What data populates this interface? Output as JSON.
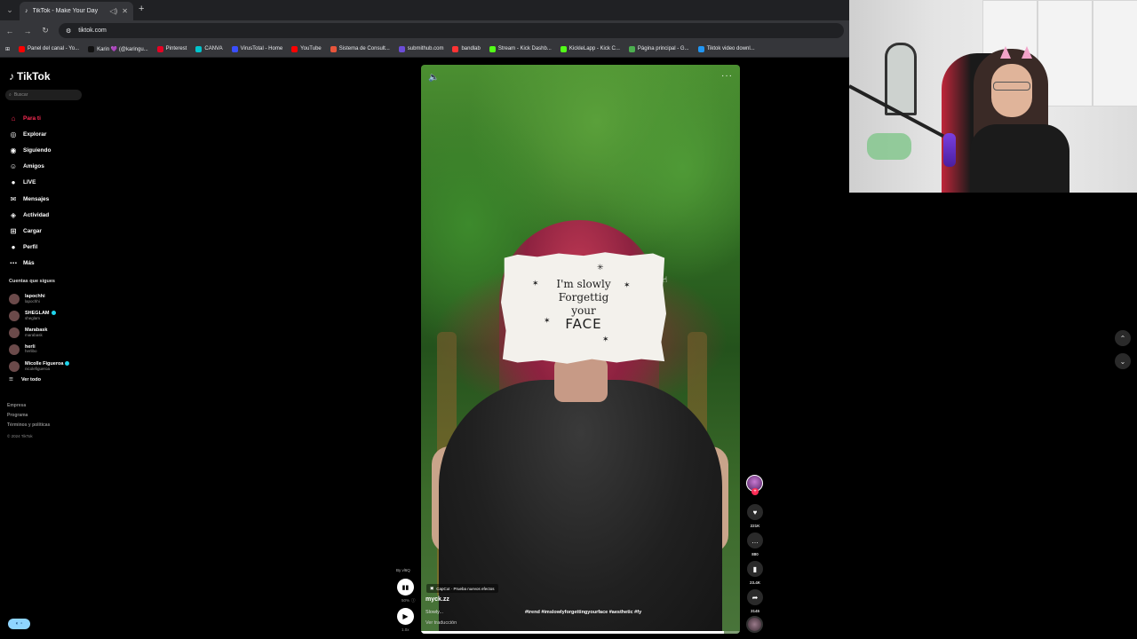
{
  "browser": {
    "tab_title": "TikTok - Make Your Day",
    "new_tab": "+",
    "url": "tiktok.com",
    "bookmarks": [
      {
        "label": "Panel del canal - Yo...",
        "color": "#ff0000"
      },
      {
        "label": "Karin 💜 (@karingu...",
        "color": "#111111"
      },
      {
        "label": "Pinterest",
        "color": "#e60023"
      },
      {
        "label": "CANVA",
        "color": "#00c4cc"
      },
      {
        "label": "VirusTotal - Home",
        "color": "#394eff"
      },
      {
        "label": "YouTube",
        "color": "#ff0000"
      },
      {
        "label": "Sistema de Consult...",
        "color": "#e8553b"
      },
      {
        "label": "submithub.com",
        "color": "#6c4dd8"
      },
      {
        "label": "bandlab",
        "color": "#f33"
      },
      {
        "label": "Stream - Kick Dashb...",
        "color": "#53fc18"
      },
      {
        "label": "KickleLapp - Kick C...",
        "color": "#53fc18"
      },
      {
        "label": "Página principal - G...",
        "color": "#4caf50"
      },
      {
        "label": "Tiktok video downl...",
        "color": "#2196f3"
      }
    ]
  },
  "sidebar": {
    "logo": "TikTok",
    "search_placeholder": "Buscar",
    "nav": [
      {
        "label": "Para ti",
        "icon": "home-icon",
        "glyph": "⌂",
        "active": true
      },
      {
        "label": "Explorar",
        "icon": "compass-icon",
        "glyph": "◎",
        "active": false
      },
      {
        "label": "Siguiendo",
        "icon": "following-icon",
        "glyph": "◉",
        "active": false
      },
      {
        "label": "Amigos",
        "icon": "friends-icon",
        "glyph": "☺",
        "active": false
      },
      {
        "label": "LIVE",
        "icon": "live-icon",
        "glyph": "●",
        "active": false
      },
      {
        "label": "Mensajes",
        "icon": "messages-icon",
        "glyph": "✉",
        "active": false
      },
      {
        "label": "Actividad",
        "icon": "activity-icon",
        "glyph": "◈",
        "active": false
      },
      {
        "label": "Cargar",
        "icon": "upload-icon",
        "glyph": "⊞",
        "active": false
      },
      {
        "label": "Perfil",
        "icon": "profile-icon",
        "glyph": "●",
        "active": false
      },
      {
        "label": "Más",
        "icon": "more-icon",
        "glyph": "⋯",
        "active": false
      }
    ],
    "following_title": "Cuentas que sigues",
    "following": [
      {
        "name": "lapochhi",
        "handle": "lapochhi",
        "verified": false
      },
      {
        "name": "SHEGLAM",
        "handle": "sheglam",
        "verified": true
      },
      {
        "name": "Marabask",
        "handle": "marabask",
        "verified": false
      },
      {
        "name": "herli",
        "handle": "herlibo",
        "verified": false
      },
      {
        "name": "Micolle Figueroa",
        "handle": "nicolefigueroa",
        "verified": true
      }
    ],
    "see_all": "Ver todo",
    "footer": [
      "Empresa",
      "Programa",
      "Términos y políticas"
    ],
    "copyright": "© 2024 TikTok"
  },
  "video": {
    "sign_line1": "I'm slowly",
    "sign_line2": "Forgettig",
    "sign_line3": "your",
    "sign_line4": "FACE",
    "capcut_label": "CapCut · Prueba nuevos efectos",
    "author": "myck.zz",
    "caption": "Slowly...",
    "hashtags": "#trend #imslowlyforgettingyourface #aesthetic #fy",
    "translate": "Ver traducción",
    "progress": 0.95
  },
  "controls": {
    "by_label": "By vl6Q",
    "stat1": "50%",
    "stat2": "1.0x"
  },
  "actions": {
    "likes": "221K",
    "comments": "880",
    "saves": "23.4K",
    "shares": "3145"
  }
}
